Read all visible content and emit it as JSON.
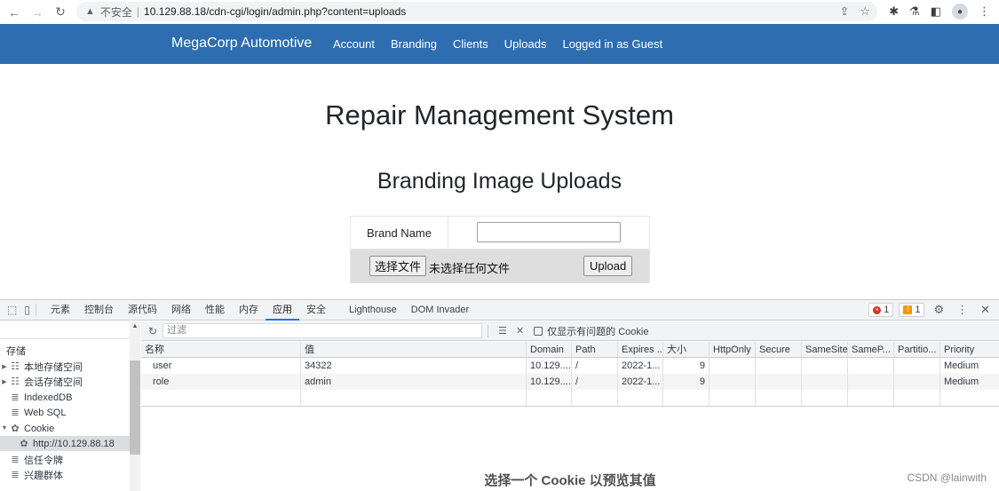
{
  "browser": {
    "security_label": "不安全",
    "url": "10.129.88.18/cdn-cgi/login/admin.php?content=uploads"
  },
  "site": {
    "brand": "MegaCorp Automotive",
    "nav": [
      "Account",
      "Branding",
      "Clients",
      "Uploads",
      "Logged in as Guest"
    ],
    "nav_color": "#2d6db0"
  },
  "page": {
    "title": "Repair Management System",
    "subtitle": "Branding Image Uploads",
    "form": {
      "brand_label": "Brand Name",
      "brand_value": "",
      "file_button": "选择文件",
      "file_status": "未选择任何文件",
      "upload_button": "Upload"
    }
  },
  "devtools": {
    "tabs": [
      "元素",
      "控制台",
      "源代码",
      "网络",
      "性能",
      "内存",
      "应用",
      "安全",
      "Lighthouse",
      "DOM Invader"
    ],
    "active_tab": "应用",
    "error_count": "1",
    "warning_count": "1",
    "sidebar": {
      "section": "存储",
      "items": [
        {
          "label": "本地存储空间",
          "icon": "grid-icon"
        },
        {
          "label": "会话存储空间",
          "icon": "grid-icon"
        },
        {
          "label": "IndexedDB",
          "icon": "database-icon"
        },
        {
          "label": "Web SQL",
          "icon": "database-icon"
        },
        {
          "label": "Cookie",
          "icon": "cookie-icon"
        },
        {
          "label": "http://10.129.88.18",
          "icon": "cookie-icon"
        },
        {
          "label": "信任令牌",
          "icon": "database-icon"
        },
        {
          "label": "兴趣群体",
          "icon": "database-icon"
        }
      ]
    },
    "toolbar": {
      "filter_placeholder": "过滤",
      "only_issues_label": "仅显示有问题的 Cookie"
    },
    "table": {
      "columns": [
        "名称",
        "值",
        "Domain",
        "Path",
        "Expires ...",
        "大小",
        "HttpOnly",
        "Secure",
        "SameSite",
        "SameP...",
        "Partitio...",
        "Priority"
      ],
      "rows": [
        [
          "user",
          "34322",
          "10.129....",
          "/",
          "2022-1...",
          "9",
          "",
          "",
          "",
          "",
          "",
          "Medium"
        ],
        [
          "role",
          "admin",
          "10.129....",
          "/",
          "2022-1...",
          "9",
          "",
          "",
          "",
          "",
          "",
          "Medium"
        ]
      ]
    },
    "preview_hint": "选择一个 Cookie 以预览其值"
  },
  "watermark": "CSDN @lainwith"
}
